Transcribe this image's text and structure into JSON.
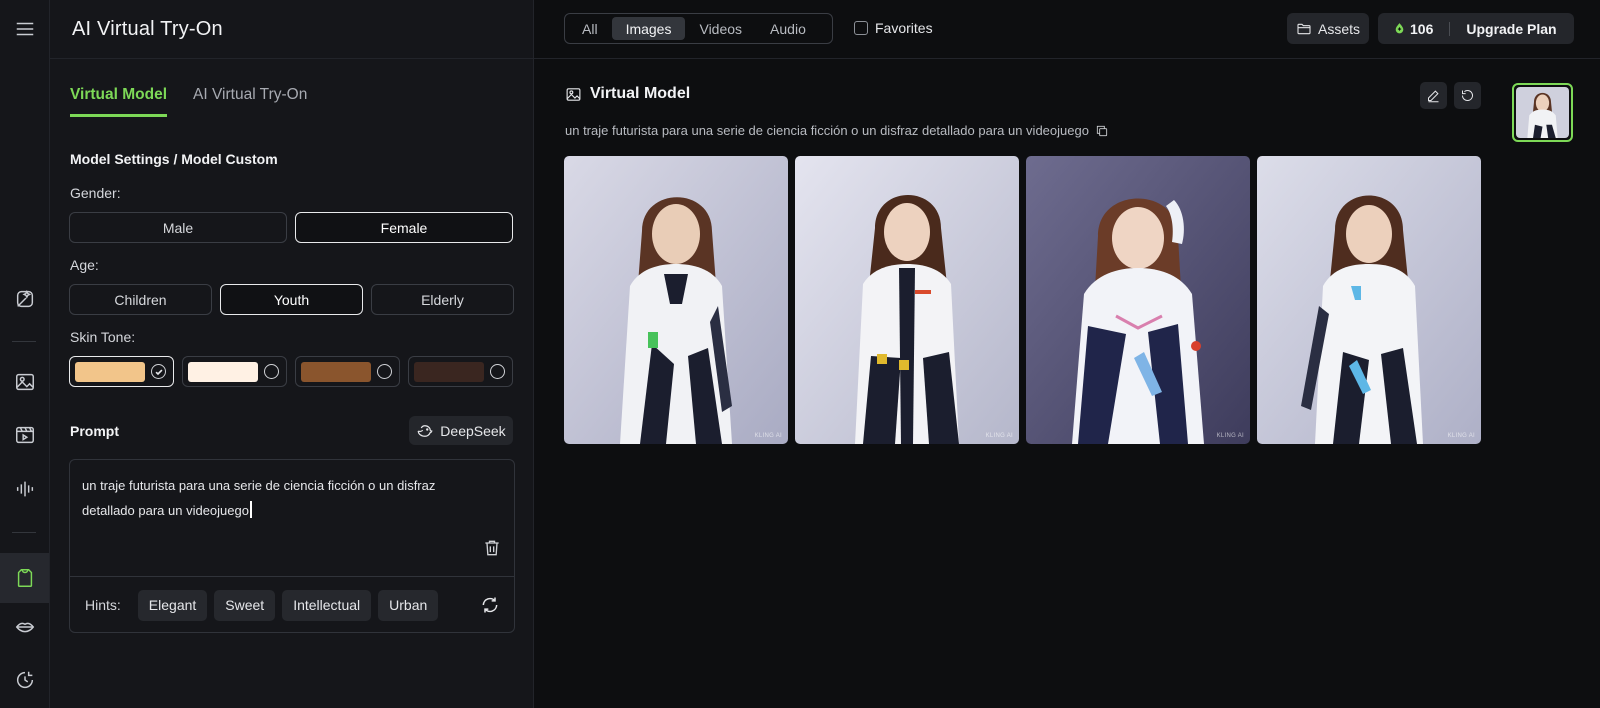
{
  "app": {
    "title": "AI Virtual Try-On"
  },
  "panel": {
    "tabs": [
      {
        "label": "Virtual Model",
        "active": true
      },
      {
        "label": "AI Virtual Try-On",
        "active": false
      }
    ],
    "section_title": "Model Settings / Model Custom",
    "gender": {
      "label": "Gender:",
      "options": [
        "Male",
        "Female"
      ],
      "selected": "Female"
    },
    "age": {
      "label": "Age:",
      "options": [
        "Children",
        "Youth",
        "Elderly"
      ],
      "selected": "Youth"
    },
    "skin_tone": {
      "label": "Skin Tone:",
      "options": [
        "#f2c58a",
        "#fff1e4",
        "#8a552d",
        "#3a2620"
      ],
      "selected_index": 0
    },
    "prompt": {
      "label": "Prompt",
      "assistant_button": "DeepSeek",
      "text": "un traje futurista para una serie de ciencia ficción o un disfraz detallado para un videojuego",
      "hints_label": "Hints:",
      "hints": [
        "Elegant",
        "Sweet",
        "Intellectual",
        "Urban"
      ]
    }
  },
  "topbar": {
    "filters": [
      "All",
      "Images",
      "Videos",
      "Audio"
    ],
    "active_filter": "Images",
    "favorites_label": "Favorites",
    "assets_label": "Assets",
    "credits": "106",
    "upgrade_label": "Upgrade Plan"
  },
  "result": {
    "title": "Virtual Model",
    "description": "un traje futurista para una serie de ciencia ficción o un disfraz detallado para un videojuego",
    "image_count": 4,
    "watermark": "KLING AI"
  },
  "colors": {
    "accent": "#7dd957",
    "background": "#0d0e10",
    "panel": "#15161a"
  }
}
